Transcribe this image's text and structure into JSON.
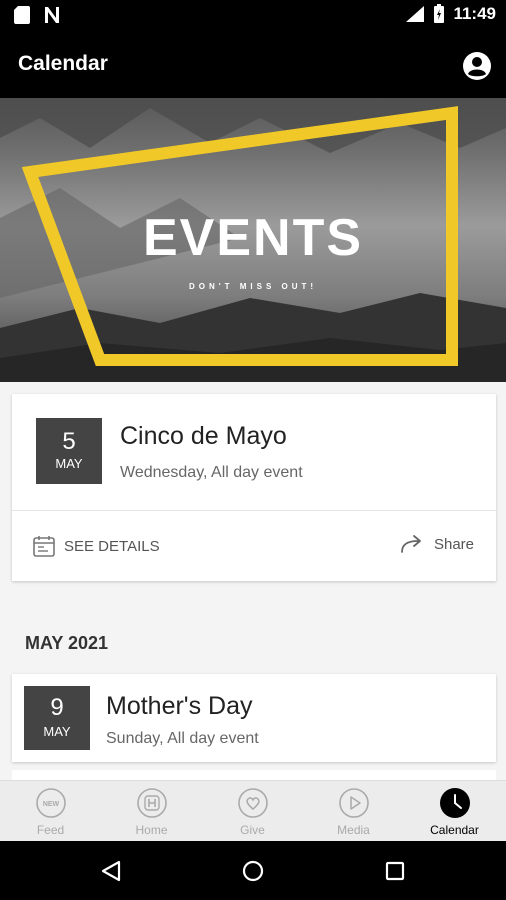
{
  "status_bar": {
    "time": "11:49",
    "network": "LTE"
  },
  "app_bar": {
    "title": "Calendar",
    "profile_icon": "account-circle-icon"
  },
  "hero": {
    "title": "EVENTS",
    "subtitle": "DON'T MISS OUT!",
    "accent_color": "#f0c929"
  },
  "featured_event": {
    "day": "5",
    "month": "MAY",
    "title": "Cinco de Mayo",
    "subtitle": "Wednesday, All day event",
    "details_label": "SEE DETAILS",
    "share_label": "Share"
  },
  "section": {
    "header": "MAY 2021"
  },
  "events": [
    {
      "day": "9",
      "month": "MAY",
      "title": "Mother's Day",
      "subtitle": "Sunday, All day event"
    }
  ],
  "tabs": [
    {
      "label": "Feed",
      "icon": "new-badge-icon"
    },
    {
      "label": "Home",
      "icon": "home-h-icon"
    },
    {
      "label": "Give",
      "icon": "heart-icon"
    },
    {
      "label": "Media",
      "icon": "play-icon"
    },
    {
      "label": "Calendar",
      "icon": "clock-icon",
      "active": true
    }
  ]
}
